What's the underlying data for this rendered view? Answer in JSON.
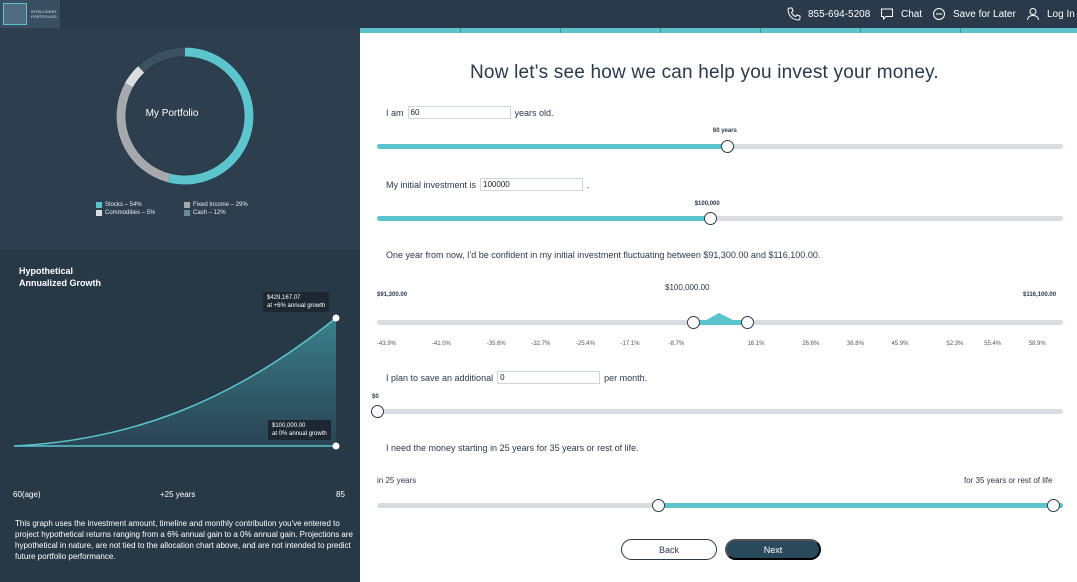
{
  "nav": {
    "logo_text": "INTELLIGENT PORTFOLIOS",
    "phone": "855-694-5208",
    "chat": "Chat",
    "save": "Save for Later",
    "login": "Log In"
  },
  "portfolio": {
    "title": "My Portfolio",
    "allocations": [
      {
        "label": "Stocks – 54%",
        "percent": 54,
        "color": "#5bc4cd"
      },
      {
        "label": "Fixed Income – 29%",
        "percent": 29,
        "color": "#a5a9ad"
      },
      {
        "label": "Commodities – 5%",
        "percent": 5,
        "color": "#d9dde0"
      },
      {
        "label": "Cash – 12%",
        "percent": 12,
        "color": "#2d3e4f"
      }
    ]
  },
  "growth": {
    "title_line1": "Hypothetical",
    "title_line2": "Annualized Growth",
    "high_value": "$429,167.07",
    "high_note": "at +6% annual growth",
    "low_value": "$100,000.00",
    "low_note": "at 0% annual growth",
    "x_start": "60(age)",
    "x_mid": "+25 years",
    "x_end": "85",
    "explanation": "This graph uses the investment amount, timeline and monthly contribution you've entered to project hypothetical returns ranging from a 6% annual gain to a 0% annual gain. Projections are hypothetical in nature, are not tied to the allocation chart above, and are not intended to predict future portfolio performance."
  },
  "form": {
    "headline": "Now let's see how we can help you invest your money.",
    "age": {
      "prefix": "I am",
      "value": "60",
      "suffix": "years old.",
      "slider_label": "60 years",
      "fraction": 0.51
    },
    "investment": {
      "prefix": "My initial investment is",
      "value": "100000",
      "suffix": ".",
      "slider_label": "$100,000",
      "fraction": 0.485
    },
    "fluctuation": {
      "text": "One year from now, I'd be confident in my initial investment fluctuating between $91,300.00 and $116,100.00.",
      "center_value": "$100,000.00",
      "low_label": "$91,300.00",
      "high_label": "$116,100.00",
      "low_fraction": 0.46,
      "high_fraction": 0.54,
      "percents": [
        "-43.9%",
        "-41.0%",
        "-35.6%",
        "-32.7%",
        "-25.4%",
        "-17.1%",
        "-8.7%",
        "16.1%",
        "26.6%",
        "36.8%",
        "45.9%",
        "52.3%",
        "55.4%",
        "58.9%"
      ]
    },
    "savings": {
      "prefix": "I plan to save an additional",
      "value": "0",
      "suffix": "per month.",
      "slider_label": "$0",
      "fraction": 0.0
    },
    "timeline": {
      "text": "I need the money starting in 25 years for 35 years or rest of life.",
      "left_label": "in 25 years",
      "right_label": "for 35 years or rest of life",
      "start_fraction": 0.41,
      "end_fraction": 1.0
    },
    "back_label": "Back",
    "next_label": "Next"
  }
}
